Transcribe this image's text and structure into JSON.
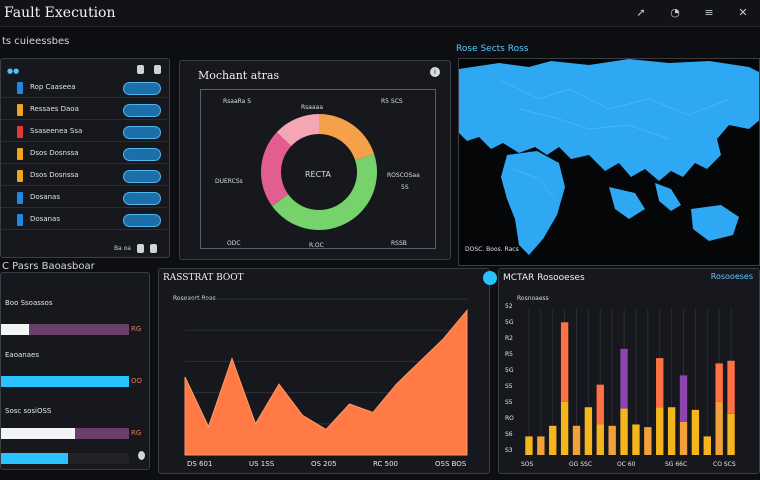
{
  "app": {
    "title": "Fault Execution",
    "icons": [
      "arrow-icon",
      "clock-icon",
      "menu-icon",
      "close-icon"
    ]
  },
  "left_section": {
    "label": "ts cuieessbes",
    "header": "Rop Caaseea",
    "rows": [
      {
        "label": "Rop Caaseea",
        "color": "#1e88e5"
      },
      {
        "label": "Ressaes Daoa",
        "color": "#f0a51c"
      },
      {
        "label": "Ssaseenea Ssa",
        "color": "#e53935"
      },
      {
        "label": "Dsos Dosnssa",
        "color": "#f0a51c"
      },
      {
        "label": "Dosanas",
        "color": "#1e88e5"
      }
    ],
    "footer": "Ba oa"
  },
  "donut_panel": {
    "title": "Mochant atras",
    "center_label": "RECTA",
    "labels": [
      "RsaaRa S",
      "Rsaaaa",
      "R5 SCS",
      "DUERCSs",
      "ROSCOSaa",
      "5S",
      "ODC",
      "R.OC",
      "RSSB"
    ],
    "colors": [
      "#f5a14a",
      "#76d36b",
      "#e15e8e",
      "#f4a6b5"
    ],
    "values": [
      20,
      45,
      22,
      13
    ]
  },
  "map_panel": {
    "title": "Rose Sects Ross",
    "caption": "DOSC. Boos. Racs",
    "land_color": "#3ab4ff"
  },
  "bars_panel": {
    "label": "C Pasrs Baoasboar",
    "bars": [
      {
        "label": "Boo Ssoassos",
        "value_label": "RG",
        "fill": 0.22,
        "fill_color": "#f3f4f6"
      },
      {
        "label": "Eaoanaes",
        "value_label": "OO",
        "fill": 1.0,
        "fill_color": "#27c2ff"
      },
      {
        "label": "Sosc sosiOSS",
        "value_label": "RG",
        "fill": 0.58,
        "fill_color": "#f3f4f6"
      },
      {
        "label": "",
        "value_label": "",
        "fill": 0.52,
        "fill_color": "#27c2ff"
      }
    ]
  },
  "area_panel": {
    "title": "RASSTRAT BOOT",
    "subtitle": "Rosoaort Roas",
    "xticks": [
      "DS 601",
      "US 1SS",
      "OS 205",
      "RC 500",
      "OSS BOS"
    ],
    "color": "#ff7a45"
  },
  "column_panel": {
    "title": "MCTAR Rosooeses",
    "badge": "Rosooeses",
    "subtitle": "Rosnoaess",
    "xticks": [
      "SOS",
      "GG SSC",
      "OC 60",
      "SG 66C",
      "CO SCS"
    ],
    "yticks": [
      "52",
      "5G",
      "R2",
      "R5",
      "5G",
      "S5",
      "S5",
      "RO",
      "S6",
      "S3"
    ],
    "colors": {
      "base": "#f5b51c",
      "mid": "#f2a13a",
      "top_orange": "#ff7043",
      "top_purple": "#8e44ad"
    }
  },
  "chart_data": [
    {
      "type": "pie",
      "title": "Mochant atras",
      "labels": [
        "",
        "",
        "",
        ""
      ],
      "values": [
        20,
        45,
        22,
        13
      ]
    },
    {
      "type": "area",
      "title": "RASSTRAT BOOT",
      "x": [
        0,
        1,
        2,
        3,
        4,
        5,
        6,
        7,
        8,
        9,
        10,
        11,
        12
      ],
      "y": [
        55,
        20,
        68,
        22,
        50,
        28,
        18,
        36,
        30,
        50,
        66,
        82,
        102
      ],
      "xticks": [
        "DS 601",
        "US 1SS",
        "OS 205",
        "RC 500",
        "OSS BOS"
      ],
      "ylim": [
        0,
        110
      ]
    },
    {
      "type": "bar",
      "title": "MCTAR Rosooeses",
      "series": [
        {
          "name": "",
          "values": [
            14,
            14,
            22,
            40,
            22,
            36,
            23,
            22,
            35,
            23,
            21,
            36,
            36,
            25,
            34,
            14,
            40,
            31
          ]
        },
        {
          "name": "",
          "values": [
            0,
            0,
            0,
            60,
            0,
            0,
            30,
            0,
            0,
            0,
            0,
            37,
            0,
            0,
            0,
            0,
            29,
            40
          ]
        },
        {
          "name": "",
          "values": [
            0,
            0,
            0,
            0,
            0,
            0,
            0,
            0,
            45,
            0,
            0,
            0,
            0,
            35,
            0,
            0,
            0,
            0
          ]
        }
      ],
      "ylim": [
        0,
        110
      ]
    }
  ]
}
